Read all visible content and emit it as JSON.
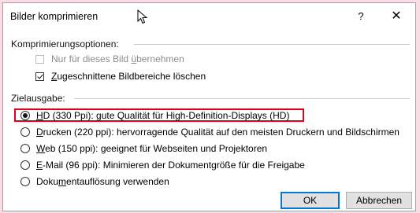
{
  "dialog": {
    "title": "Bilder komprimieren",
    "help_label": "?",
    "close_label": "✕"
  },
  "compression": {
    "heading": "Komprimierungsoptionen:",
    "options": [
      {
        "prefix": "Nur für dieses Bild ",
        "accel": "ü",
        "suffix": "bernehmen",
        "checked": false,
        "disabled": true
      },
      {
        "prefix": "",
        "accel": "Z",
        "suffix": "ugeschnittene Bildbereiche löschen",
        "checked": true,
        "disabled": false
      }
    ]
  },
  "output": {
    "heading": "Zielausgabe:",
    "options": [
      {
        "prefix": "",
        "accel": "H",
        "suffix": "D (330 Ppi): gute Qualität für High-Definition-Displays (HD)",
        "selected": true
      },
      {
        "prefix": "",
        "accel": "D",
        "suffix": "rucken (220 ppi): hervorragende Qualität auf den meisten Druckern und Bildschirmen",
        "selected": false
      },
      {
        "prefix": "",
        "accel": "W",
        "suffix": "eb (150 ppi): geeignet für Webseiten und Projektoren",
        "selected": false
      },
      {
        "prefix": "",
        "accel": "E",
        "suffix": "-Mail (96 ppi): Minimieren der Dokumentgröße für die Freigabe",
        "selected": false
      },
      {
        "prefix": "Doku",
        "accel": "m",
        "suffix": "entauflösung verwenden",
        "selected": false
      }
    ]
  },
  "buttons": {
    "ok": "OK",
    "cancel": "Abbrechen"
  },
  "colors": {
    "highlight_border": "#e0001a",
    "ok_border": "#0078d7"
  }
}
